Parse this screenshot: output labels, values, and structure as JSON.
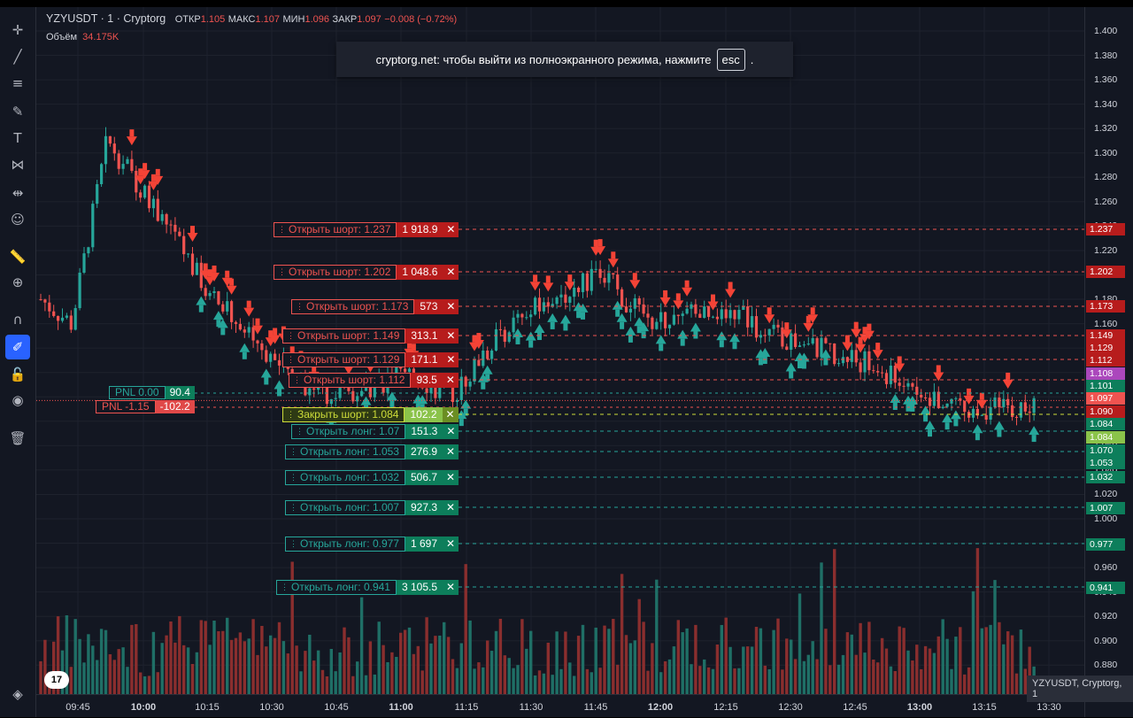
{
  "legend": {
    "symbol": "YZYUSDT",
    "interval": "1",
    "exchange": "Cryptorg",
    "open_label": "ОТКР",
    "open": "1.105",
    "high_label": "МАКС",
    "high": "1.107",
    "low_label": "МИН",
    "low": "1.096",
    "close_label": "ЗАКР",
    "close": "1.097",
    "change": "−0.008 (−0.72%)",
    "volume_label": "Объём",
    "volume": "34.175K"
  },
  "toast": {
    "text": "cryptorg.net: чтобы выйти из полноэкранного режима, нажмите",
    "key": "esc",
    "suffix": "."
  },
  "toolbar": [
    "crosshair-icon",
    "trend-line-icon",
    "fib-icon",
    "brush-icon",
    "text-icon",
    "pattern-icon",
    "measure-icon",
    "emoji-icon",
    "ruler-icon",
    "zoom-icon",
    "magnet-icon",
    "lock-drawing-icon",
    "lock-icon",
    "eye-icon",
    "trash-icon",
    "layers-icon"
  ],
  "price_ticks": [
    "1.400",
    "1.380",
    "1.360",
    "1.340",
    "1.320",
    "1.300",
    "1.280",
    "1.260",
    "1.240",
    "1.220",
    "1.200",
    "1.180",
    "1.160",
    "1.140",
    "1.120",
    "1.100",
    "1.080",
    "1.060",
    "1.040",
    "1.020",
    "1.000",
    "0.980",
    "0.960",
    "0.940",
    "0.920",
    "0.900",
    "0.880"
  ],
  "price_labels": [
    {
      "text": "1.237",
      "color": "#b71c1c"
    },
    {
      "text": "1.202",
      "color": "#b71c1c"
    },
    {
      "text": "1.173",
      "color": "#b71c1c"
    },
    {
      "text": "1.149",
      "color": "#b71c1c"
    },
    {
      "text": "1.129",
      "color": "#b71c1c"
    },
    {
      "text": "1.112",
      "color": "#b71c1c"
    },
    {
      "text": "1.108",
      "color": "#ab47bc"
    },
    {
      "text": "1.101",
      "color": "#0d7e5b"
    },
    {
      "text": "1.097",
      "color": "#ef5350"
    },
    {
      "text": "1.090",
      "color": "#b71c1c"
    },
    {
      "text": "1.084",
      "color": "#0d7e5b"
    },
    {
      "text": "1.084",
      "color": "#8bc34a"
    },
    {
      "text": "1.070",
      "color": "#0d7e5b"
    },
    {
      "text": "1.053",
      "color": "#0d7e5b"
    },
    {
      "text": "1.032",
      "color": "#0d7e5b"
    },
    {
      "text": "1.007",
      "color": "#0d7e5b"
    },
    {
      "text": "0.977",
      "color": "#0d7e5b"
    },
    {
      "text": "0.941",
      "color": "#0d7e5b"
    }
  ],
  "time_ticks": [
    {
      "t": "09:45",
      "major": false
    },
    {
      "t": "10:00",
      "major": true
    },
    {
      "t": "10:15",
      "major": false
    },
    {
      "t": "10:30",
      "major": false
    },
    {
      "t": "10:45",
      "major": false
    },
    {
      "t": "11:00",
      "major": true
    },
    {
      "t": "11:15",
      "major": false
    },
    {
      "t": "11:30",
      "major": false
    },
    {
      "t": "11:45",
      "major": false
    },
    {
      "t": "12:00",
      "major": true
    },
    {
      "t": "12:15",
      "major": false
    },
    {
      "t": "12:30",
      "major": false
    },
    {
      "t": "12:45",
      "major": false
    },
    {
      "t": "13:00",
      "major": true
    },
    {
      "t": "13:15",
      "major": false
    },
    {
      "t": "13:30",
      "major": false
    }
  ],
  "orders": [
    {
      "kind": "short",
      "label": "Открыть шорт: 1.237",
      "qty": "1 918.9",
      "price": 1.237
    },
    {
      "kind": "short",
      "label": "Открыть шорт: 1.202",
      "qty": "1 048.6",
      "price": 1.202
    },
    {
      "kind": "short",
      "label": "Открыть шорт: 1.173",
      "qty": "573",
      "price": 1.173
    },
    {
      "kind": "short",
      "label": "Открыть шорт: 1.149",
      "qty": "313.1",
      "price": 1.149
    },
    {
      "kind": "short",
      "label": "Открыть шорт: 1.129",
      "qty": "171.1",
      "price": 1.129
    },
    {
      "kind": "short",
      "label": "Открыть шорт: 1.112",
      "qty": "93.5",
      "price": 1.112
    },
    {
      "kind": "close",
      "label": "Закрыть шорт: 1.084",
      "qty": "102.2",
      "price": 1.084
    },
    {
      "kind": "long",
      "label": "Открыть лонг: 1.07",
      "qty": "151.3",
      "price": 1.07
    },
    {
      "kind": "long",
      "label": "Открыть лонг: 1.053",
      "qty": "276.9",
      "price": 1.053
    },
    {
      "kind": "long",
      "label": "Открыть лонг: 1.032",
      "qty": "506.7",
      "price": 1.032
    },
    {
      "kind": "long",
      "label": "Открыть лонг: 1.007",
      "qty": "927.3",
      "price": 1.007
    },
    {
      "kind": "long",
      "label": "Открыть лонг: 0.977",
      "qty": "1 697",
      "price": 0.977
    },
    {
      "kind": "long",
      "label": "Открыть лонг: 0.941",
      "qty": "3 105.5",
      "price": 0.941
    }
  ],
  "pnl": [
    {
      "label": "PNL  0.00",
      "value": "90.4",
      "color": "#26a69a",
      "bg": "#0d7e5b",
      "price": 1.101
    },
    {
      "label": "PNL  -1.15",
      "value": "-102.2",
      "color": "#ef5350",
      "bg": "#e04848",
      "price": 1.09
    }
  ],
  "symbol_badge": "YZYUSDT, Cryptorg, 1",
  "tv_logo": "17",
  "colors": {
    "up": "#26a69a",
    "down": "#ef5350",
    "bg": "#131722",
    "grid": "#1e222d"
  }
}
